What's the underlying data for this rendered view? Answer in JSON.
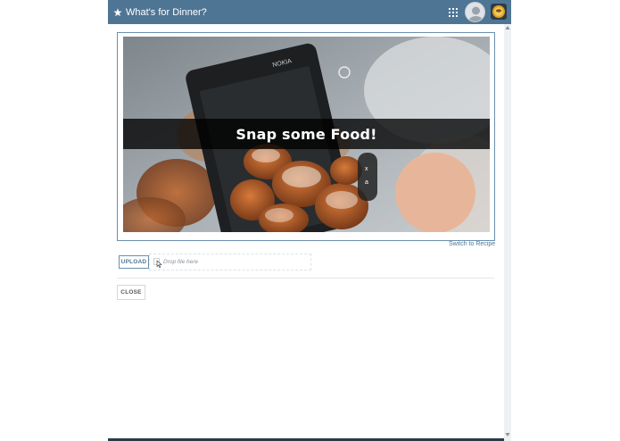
{
  "window": {
    "title": "What's for Dinner?",
    "accent_color": "#4f7595"
  },
  "header_icons": [
    "star-icon",
    "apps-grid-icon",
    "user-avatar",
    "app-logo-icon"
  ],
  "image_panel": {
    "banner_text": "Snap some Food!",
    "photo_description_icons": [
      "phone-photo-of-food"
    ]
  },
  "switch_link": "Switch to Recipe",
  "upload": {
    "button_label": "UPLOAD",
    "dropzone_placeholder": "Drop file here"
  },
  "footer": {
    "close_label": "CLOSE"
  }
}
